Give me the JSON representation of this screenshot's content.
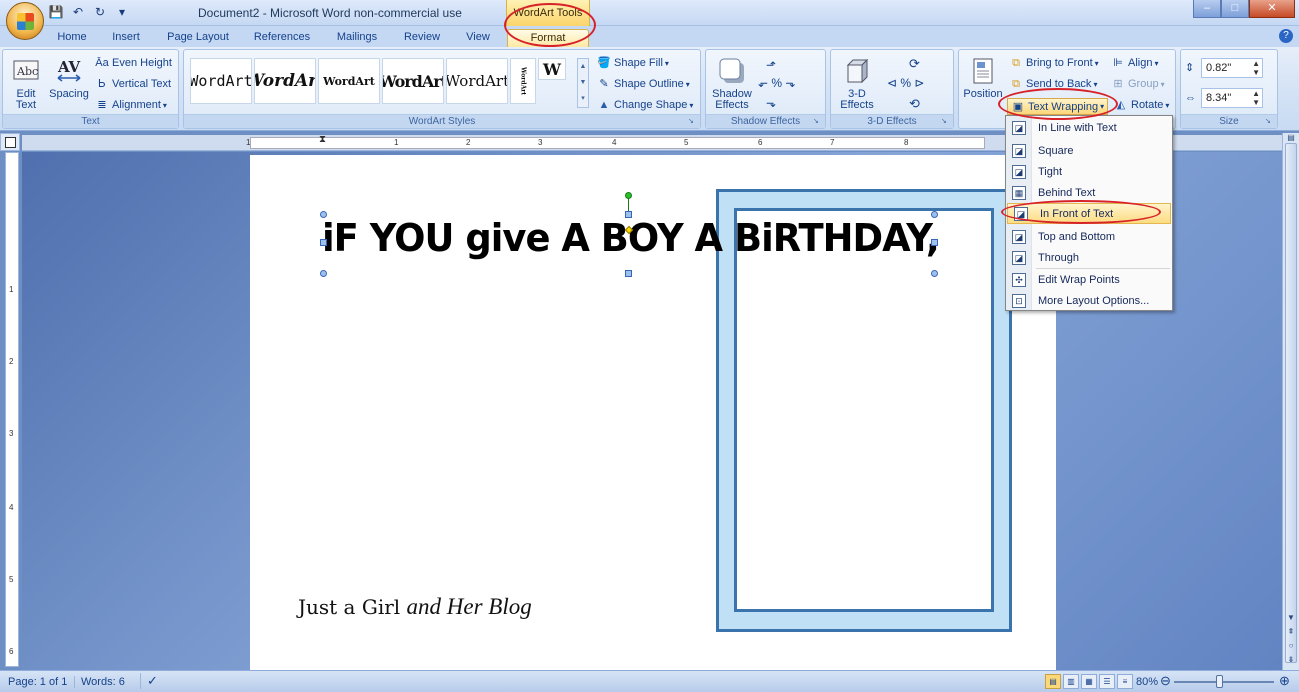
{
  "window": {
    "title": "Document2 - Microsoft Word non-commercial use",
    "context_tab": "WordArt Tools",
    "controls": {
      "minimize": "–",
      "maximize": "□",
      "close": "✕"
    }
  },
  "tabs": [
    {
      "label": "Home"
    },
    {
      "label": "Insert"
    },
    {
      "label": "Page Layout"
    },
    {
      "label": "References"
    },
    {
      "label": "Mailings"
    },
    {
      "label": "Review"
    },
    {
      "label": "View"
    },
    {
      "label": "Format",
      "active": true
    }
  ],
  "ribbon": {
    "text_group": {
      "label": "Text",
      "edit_text": "Edit Text",
      "spacing": "Spacing",
      "even_height": "Even Height",
      "vertical_text": "Vertical Text",
      "alignment": "Alignment"
    },
    "wordart_styles": {
      "label": "WordArt Styles",
      "gallery": [
        "WordArt",
        "WordArt",
        "WordArt",
        "WordArt",
        "WordArt",
        "WordArt",
        "W"
      ],
      "shape_fill": "Shape Fill",
      "shape_outline": "Shape Outline",
      "change_shape": "Change Shape"
    },
    "shadow_group": {
      "label": "Shadow Effects",
      "shadow_effects": "Shadow Effects"
    },
    "threed_group": {
      "label": "3-D Effects",
      "threed_effects": "3-D Effects"
    },
    "arrange_group": {
      "position": "Position",
      "bring_to_front": "Bring to Front",
      "send_to_back": "Send to Back",
      "text_wrapping": "Text Wrapping",
      "align": "Align",
      "group": "Group",
      "rotate": "Rotate"
    },
    "size_group": {
      "label": "Size",
      "height": "0.82\"",
      "width": "8.34\""
    }
  },
  "text_wrapping_menu": [
    {
      "label": "In Line with Text"
    },
    {
      "label": "Square"
    },
    {
      "label": "Tight"
    },
    {
      "label": "Behind Text"
    },
    {
      "label": "In Front of Text",
      "highlighted": true
    },
    {
      "label": "Top and Bottom"
    },
    {
      "label": "Through"
    },
    {
      "label": "Edit Wrap Points"
    },
    {
      "label": "More Layout Options..."
    }
  ],
  "document": {
    "wordart_text": "iF YOU give A BOY A BiRTHDAY,",
    "footer_plain": "Just a Girl ",
    "footer_script": "and Her Blog"
  },
  "ruler": {
    "ticks": [
      "1",
      "1",
      "2",
      "3",
      "4",
      "5",
      "6",
      "7",
      "8"
    ]
  },
  "vruler": {
    "ticks": [
      "1",
      "2",
      "3",
      "4",
      "5",
      "6"
    ]
  },
  "status": {
    "page": "Page: 1 of 1",
    "words": "Words: 6",
    "zoom": "80%"
  },
  "colors": {
    "annotation": "#d8222a",
    "frame_border": "#3b73ad",
    "frame_fill": "#bfe0f5"
  }
}
